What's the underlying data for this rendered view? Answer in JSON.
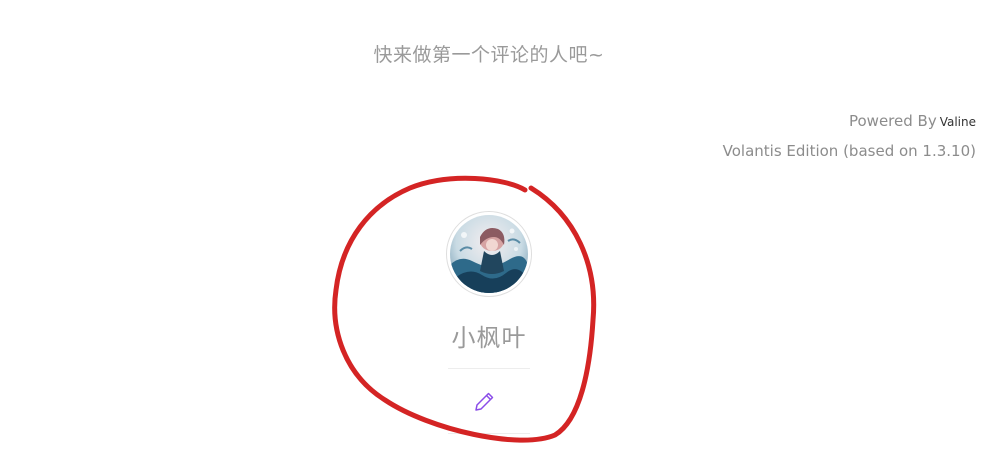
{
  "comments": {
    "empty_message": "快来做第一个评论的人吧~",
    "powered_by_label": "Powered By",
    "powered_by_link": "Valine",
    "edition": "Volantis Edition (based on 1.3.10)"
  },
  "author_card": {
    "name": "小枫叶",
    "avatar_icon": "anime-girl-avatar",
    "edit_icon": "pencil-icon",
    "edit_icon_color": "#8a4de8"
  },
  "annotation": {
    "shape": "hand-drawn-circle",
    "color": "#d42424"
  }
}
